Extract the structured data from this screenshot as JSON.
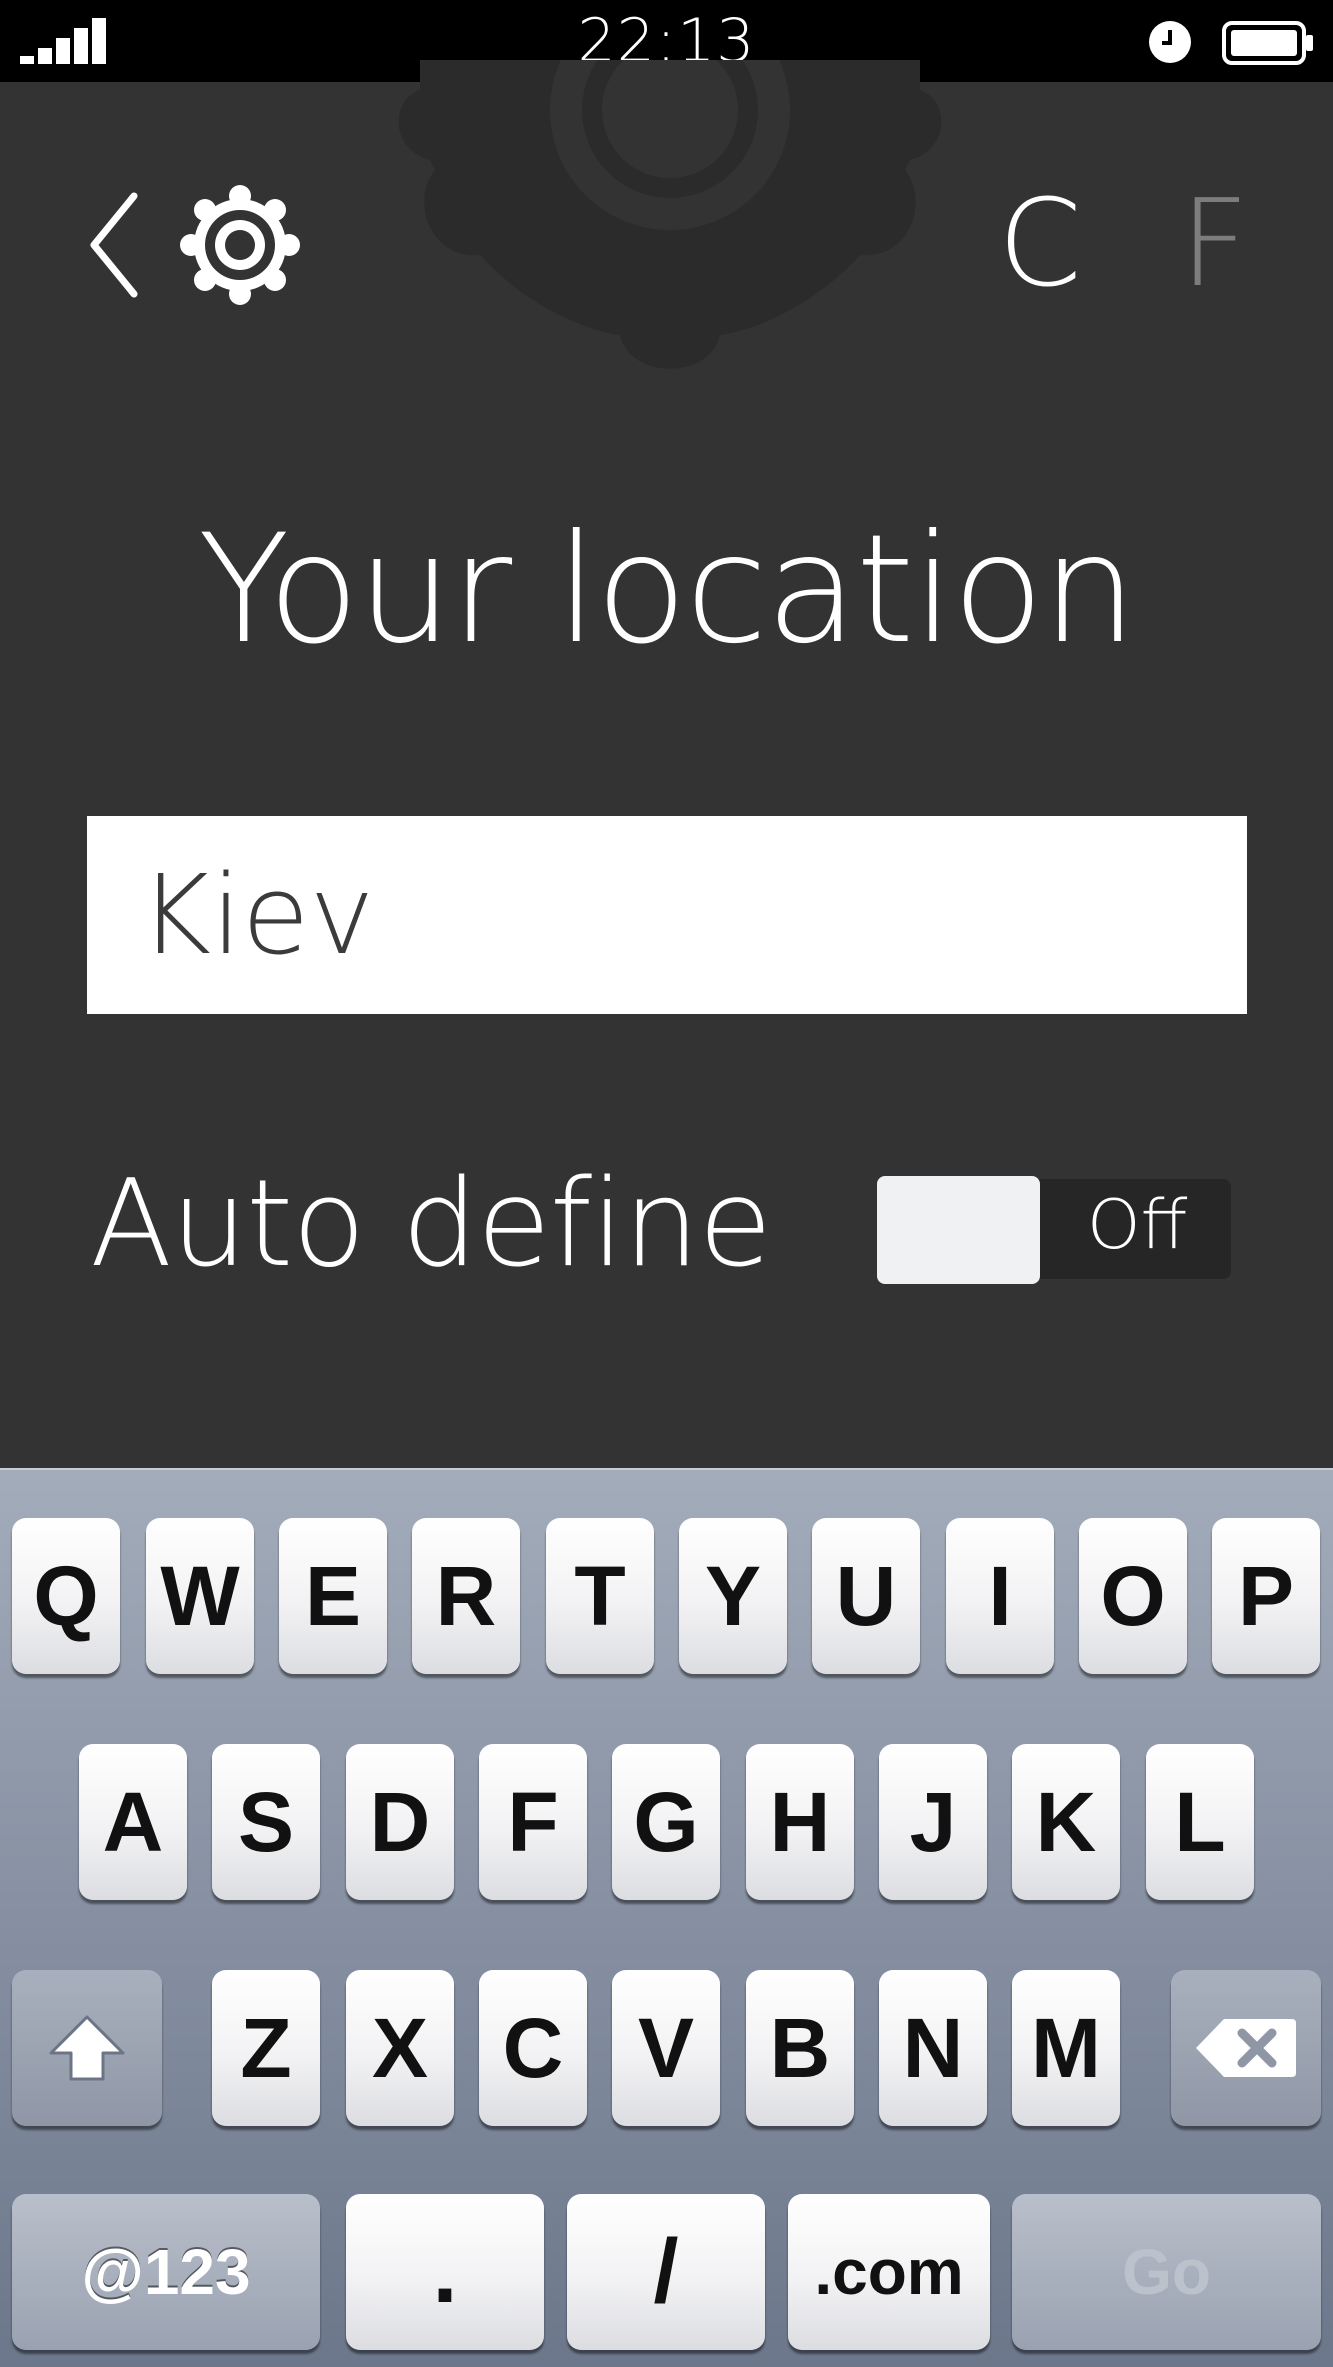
{
  "status_bar": {
    "time": "22:13",
    "signal_icon": "signal-bars-icon",
    "alarm_icon": "alarm-clock-icon",
    "battery_icon": "battery-icon"
  },
  "header": {
    "back_icon": "chevron-left-icon",
    "settings_icon": "gear-icon",
    "unit_celsius": "C",
    "unit_fahrenheit": "F",
    "selected_unit": "C"
  },
  "title": "Your location",
  "location_input": {
    "value": "Kiev"
  },
  "auto_define": {
    "label": "Auto define",
    "toggle_state": "Off"
  },
  "keyboard": {
    "row1": [
      "Q",
      "W",
      "E",
      "R",
      "T",
      "Y",
      "U",
      "I",
      "O",
      "P"
    ],
    "row2": [
      "A",
      "S",
      "D",
      "F",
      "G",
      "H",
      "J",
      "K",
      "L"
    ],
    "row3": [
      "Z",
      "X",
      "C",
      "V",
      "B",
      "N",
      "M"
    ],
    "shift_icon": "shift-arrow-icon",
    "backspace_icon": "backspace-icon",
    "bottom": {
      "symbols": "@123",
      "dot": ".",
      "slash": "/",
      "dotcom": ".com",
      "go": "Go"
    }
  },
  "colors": {
    "background": "#333333",
    "status_bar": "#000000",
    "inactive_unit": "#7d7d7d"
  }
}
